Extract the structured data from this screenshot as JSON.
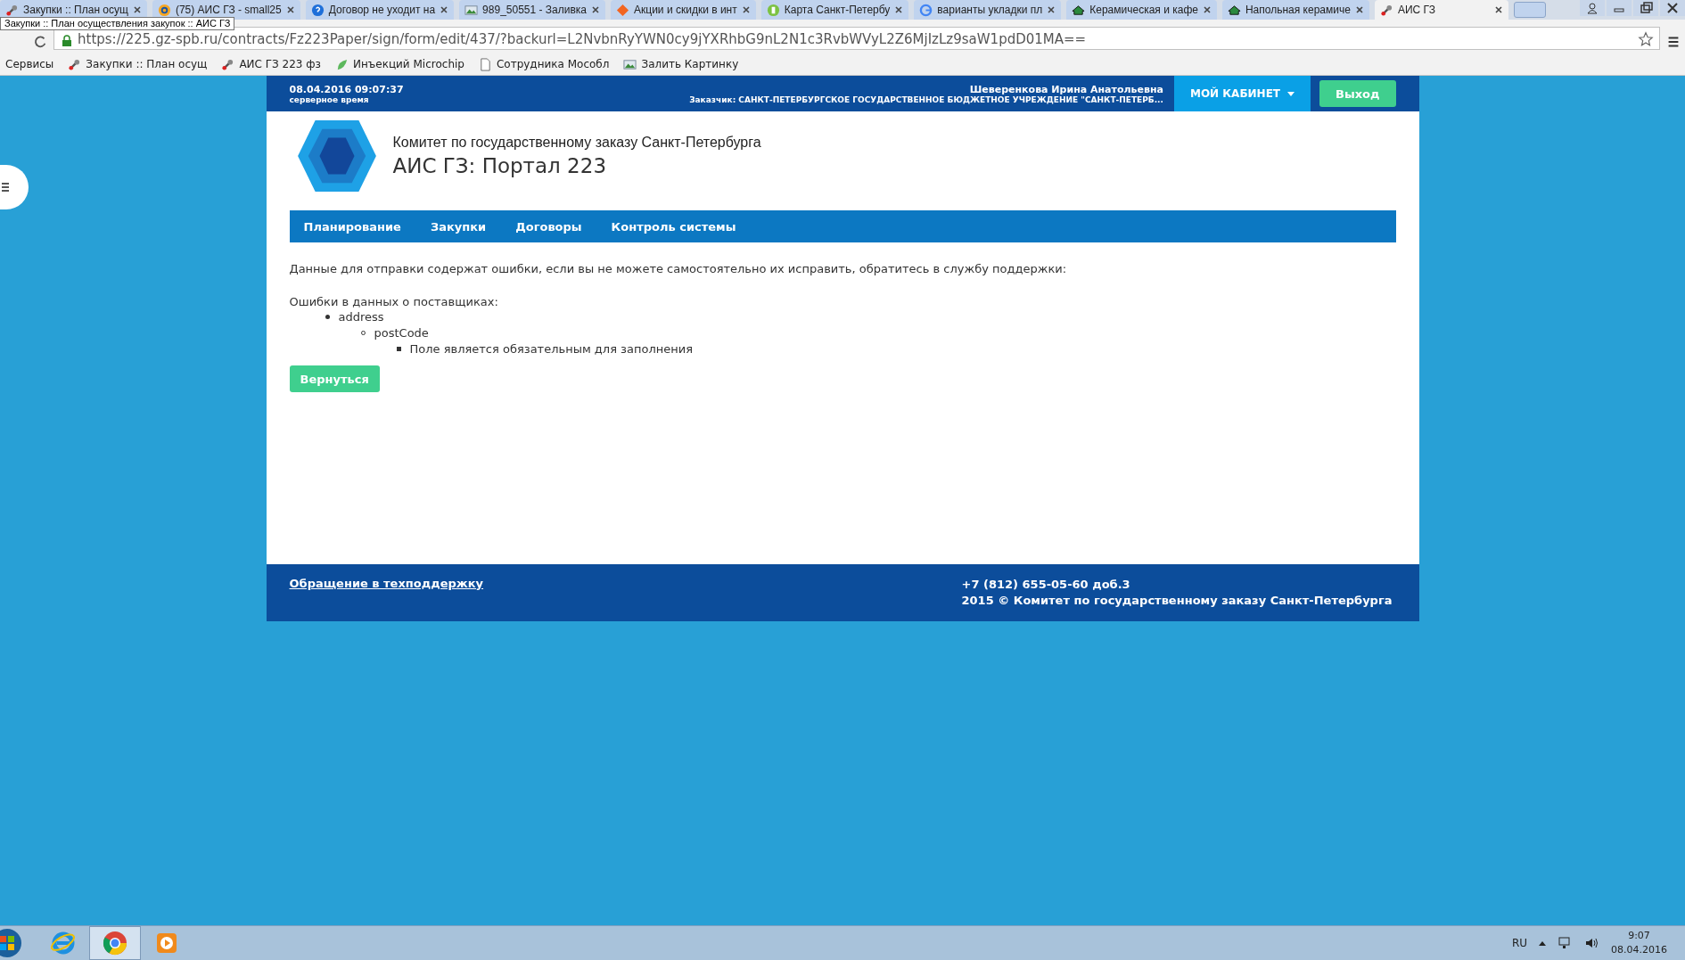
{
  "browser": {
    "tabs": [
      {
        "title": "Закупки :: План осущ",
        "selected": false
      },
      {
        "title": "(75) АИС ГЗ - small25",
        "selected": false
      },
      {
        "title": "Договор не уходит на",
        "selected": false
      },
      {
        "title": "989_50551 - Заливка",
        "selected": false
      },
      {
        "title": "Акции и скидки в инт",
        "selected": false
      },
      {
        "title": "Карта Санкт-Петербу",
        "selected": false
      },
      {
        "title": "варианты укладки пл",
        "selected": false
      },
      {
        "title": "Керамическая и кафе",
        "selected": false
      },
      {
        "title": "Напольная керамиче",
        "selected": false
      },
      {
        "title": "АИС ГЗ",
        "selected": true
      }
    ],
    "tooltip": "Закупки :: План осуществления закупок :: АИС ГЗ",
    "url": "https://225.gz-spb.ru/contracts/Fz223Paper/sign/form/edit/437/?backurl=L2NvbnRyYWN0cy9jYXRhbG9nL2N1c3RvbWVyL2Z6MjIzLz9saW1pdD01MA==",
    "bookmarks": [
      "Сервисы",
      "Закупки :: План осущ",
      "АИС ГЗ 223 фз",
      "Инъекций Microchip",
      "Сотрудника Мособл",
      "Залить Картинку"
    ]
  },
  "topbar": {
    "datetime": "08.04.2016 09:07:37",
    "time_note": "серверное время",
    "user": "Шеверенкова Ирина Анатольевна",
    "customer": "Заказчик: САНКТ-ПЕТЕРБУРГСКОЕ ГОСУДАРСТВЕННОЕ БЮДЖЕТНОЕ УЧРЕЖДЕНИЕ \"САНКТ-ПЕТЕРБ...",
    "cabinet": "МОЙ КАБИНЕТ",
    "logout": "Выход"
  },
  "brand": {
    "org": "Комитет по государственному заказу Санкт-Петербурга",
    "title": "АИС ГЗ: Портал 223"
  },
  "nav": [
    "Планирование",
    "Закупки",
    "Договоры",
    "Контроль системы"
  ],
  "content": {
    "message": "Данные для отправки содержат ошибки, если вы не можете самостоятельно их исправить, обратитесь в службу поддержки:",
    "errors_heading": "Ошибки в данных о поставщиках:",
    "errors": [
      {
        "text": "address",
        "children": [
          {
            "text": "postCode",
            "children": [
              {
                "text": "Поле является обязательным для заполнения"
              }
            ]
          }
        ]
      }
    ],
    "back_button": "Вернуться"
  },
  "footer": {
    "support_link": "Обращение в техподдержку",
    "phone": "+7 (812) 655-05-60 доб.3",
    "copyright": "2015 © Комитет по государственному заказу Санкт-Петербурга"
  },
  "taskbar": {
    "apps": [
      {
        "kind": "ie",
        "selected": false
      },
      {
        "kind": "chrome",
        "selected": true
      },
      {
        "kind": "media",
        "selected": false
      }
    ],
    "language": "RU",
    "time": "9:07",
    "date": "08.04.2016"
  }
}
